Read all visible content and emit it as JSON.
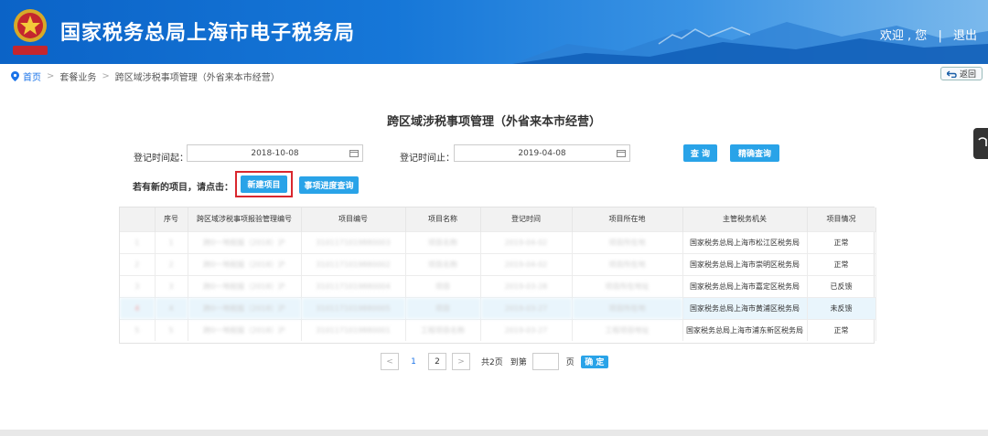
{
  "header": {
    "title": "国家税务总局上海市电子税务局",
    "welcome": "欢迎 , 您",
    "divider": "|",
    "logout": "退出",
    "emblem_text": "中国税务"
  },
  "breadcrumb": {
    "home": "首页",
    "sep1": ">",
    "item1": "套餐业务",
    "sep2": ">",
    "item2": "跨区域涉税事项管理（外省来本市经营）"
  },
  "back_label": "返回",
  "page_title": "跨区域涉税事项管理（外省来本市经营）",
  "search": {
    "start_label": "登记时间起：",
    "start_value": "2018-10-08",
    "end_label": "登记时间止：",
    "end_value": "2019-04-08",
    "query_label": "查 询",
    "precise_label": "精确查询"
  },
  "new_hint": "若有新的项目，请点击：",
  "new_project_label": "新建项目",
  "progress_query_label": "事项进度查询",
  "table": {
    "headers": [
      "",
      "序号",
      "跨区域涉税事项报验管理编号",
      "项目编号",
      "项目名称",
      "登记时间",
      "项目所在地",
      "主管税务机关",
      "项目情况"
    ],
    "rows": [
      {
        "c0": "1",
        "c1": "1",
        "c2": "跨0一地税报（2018）沪",
        "c3": "3101171019880003",
        "c4": "项目名称",
        "c5": "2019-04-02",
        "c6": "项目所在地",
        "c7": "国家税务总局上海市松江区税务局",
        "c8": "正常"
      },
      {
        "c0": "2",
        "c1": "2",
        "c2": "跨0一地税报（2018）沪",
        "c3": "3101171019880002",
        "c4": "项目名称",
        "c5": "2019-04-02",
        "c6": "项目所在地",
        "c7": "国家税务总局上海市崇明区税务局",
        "c8": "正常"
      },
      {
        "c0": "3",
        "c1": "3",
        "c2": "跨0一地税报（2018）沪",
        "c3": "3101171019880004",
        "c4": "项目",
        "c5": "2019-03-28",
        "c6": "项目所在地址",
        "c7": "国家税务总局上海市嘉定区税务局",
        "c8": "已反馈"
      },
      {
        "c0": "4",
        "c1": "4",
        "c2": "跨0一地税报（2018）沪",
        "c3": "3101171019880005",
        "c4": "项目",
        "c5": "2019-03-27",
        "c6": "项目所在地",
        "c7": "国家税务总局上海市黄浦区税务局",
        "c8": "未反馈"
      },
      {
        "c0": "5",
        "c1": "5",
        "c2": "跨0一地税报（2018）沪",
        "c3": "3101171019880001",
        "c4": "工程项目名称",
        "c5": "2019-03-27",
        "c6": "工程项目地址",
        "c7": "国家税务总局上海市浦东新区税务局",
        "c8": "正常"
      }
    ]
  },
  "pager": {
    "prev": "<",
    "page1": "1",
    "page2": "2",
    "next": ">",
    "total": "共2页",
    "goto": "到第",
    "page_unit": "页",
    "confirm": "确 定"
  },
  "colors": {
    "header_blue": "#0b63c7",
    "button_blue": "#29a3e8",
    "highlight_red": "#d9272e"
  }
}
